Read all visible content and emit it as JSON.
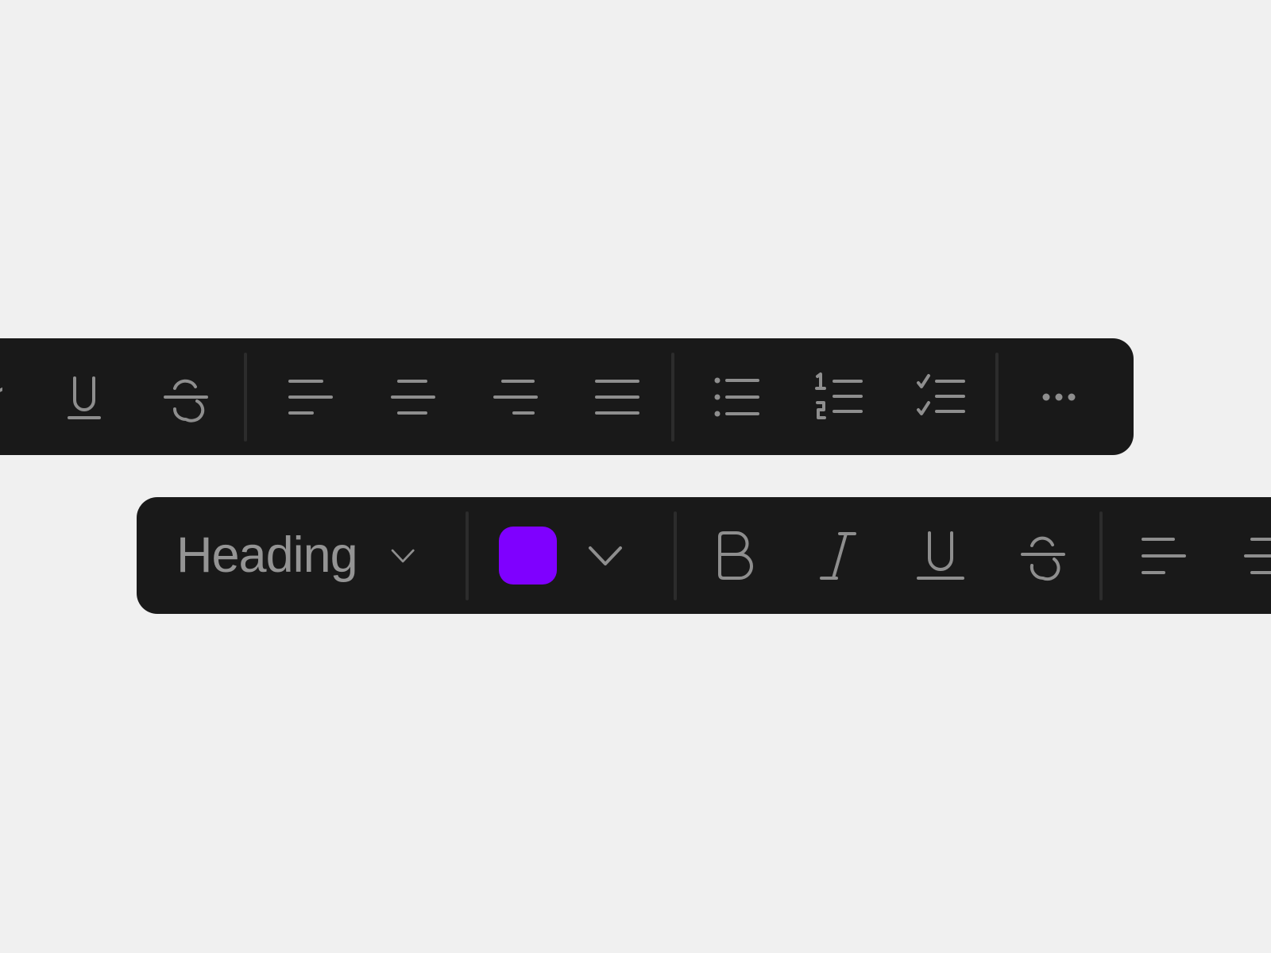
{
  "colors": {
    "background": "#f0f0f0",
    "toolbar": "#191919",
    "icon": "#8e8e8e",
    "divider": "#2c2c2c",
    "selected_text_color": "#7f00ff"
  },
  "toolbar_top": {
    "buttons": [
      {
        "icon": "underline-icon",
        "label": "Underline"
      },
      {
        "icon": "strikethrough-icon",
        "label": "Strikethrough"
      },
      {
        "icon": "align-left-icon",
        "label": "Align left"
      },
      {
        "icon": "align-center-icon",
        "label": "Align center"
      },
      {
        "icon": "align-right-icon",
        "label": "Align right"
      },
      {
        "icon": "align-justify-icon",
        "label": "Justify"
      },
      {
        "icon": "bulleted-list-icon",
        "label": "Bulleted list"
      },
      {
        "icon": "numbered-list-icon",
        "label": "Numbered list"
      },
      {
        "icon": "checklist-icon",
        "label": "Checklist"
      },
      {
        "icon": "more-icon",
        "label": "More options"
      }
    ],
    "numbered_list_glyphs": [
      "1",
      "2"
    ]
  },
  "toolbar_bottom": {
    "text_style": {
      "selected": "Heading"
    },
    "text_color": {
      "selected": "#7f00ff"
    },
    "buttons": [
      {
        "icon": "bold-icon",
        "label": "Bold"
      },
      {
        "icon": "italic-icon",
        "label": "Italic"
      },
      {
        "icon": "underline-icon",
        "label": "Underline"
      },
      {
        "icon": "strikethrough-icon",
        "label": "Strikethrough"
      },
      {
        "icon": "align-left-icon",
        "label": "Align left"
      },
      {
        "icon": "align-center-icon",
        "label": "Align center"
      }
    ]
  }
}
